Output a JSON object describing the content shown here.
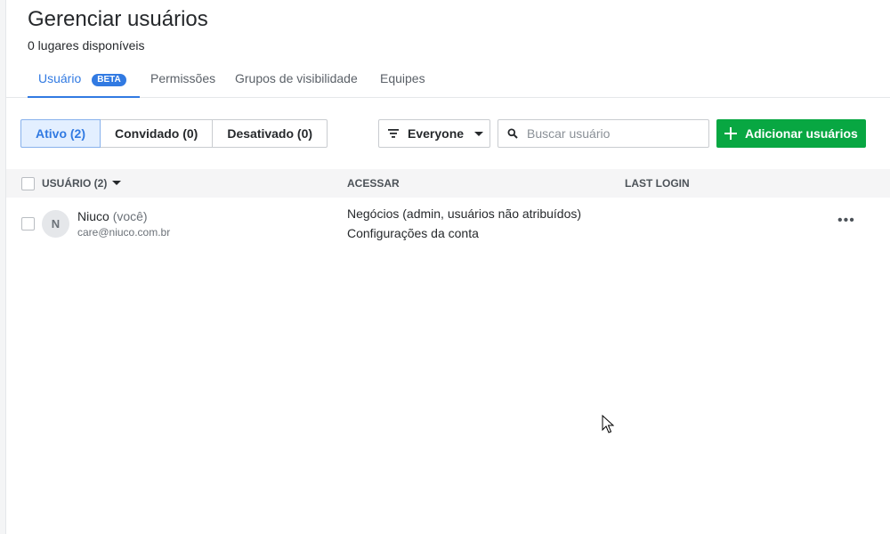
{
  "header": {
    "title": "Gerenciar usuários",
    "seats": "0 lugares disponíveis"
  },
  "tabs": [
    {
      "label": "Usuário",
      "badge": "BETA",
      "active": true
    },
    {
      "label": "Permissões"
    },
    {
      "label": "Grupos de visibilidade"
    },
    {
      "label": "Equipes"
    }
  ],
  "status_filter": {
    "options": [
      "Ativo (2)",
      "Convidado (0)",
      "Desativado (0)"
    ],
    "selected": "Ativo (2)"
  },
  "visibility_filter": {
    "label": "Everyone",
    "icon": "filter-icon"
  },
  "search": {
    "placeholder": "Buscar usuário",
    "value": "",
    "icon": "search-icon"
  },
  "add_button": {
    "label": "Adicionar usuários",
    "icon": "plus-icon"
  },
  "table": {
    "columns": {
      "user": "USUÁRIO (2)",
      "access": "ACESSAR",
      "last_login": "LAST LOGIN"
    },
    "rows": [
      {
        "initial": "N",
        "name": "Niuco",
        "you": "(você)",
        "email": "care@niuco.com.br",
        "access": [
          "Negócios (admin, usuários não atribuídos)",
          "Configurações da conta"
        ],
        "last_login": ""
      }
    ]
  },
  "colors": {
    "accent": "#317ae2",
    "primary_button": "#08a742",
    "active_segment_bg": "#e3efff"
  }
}
